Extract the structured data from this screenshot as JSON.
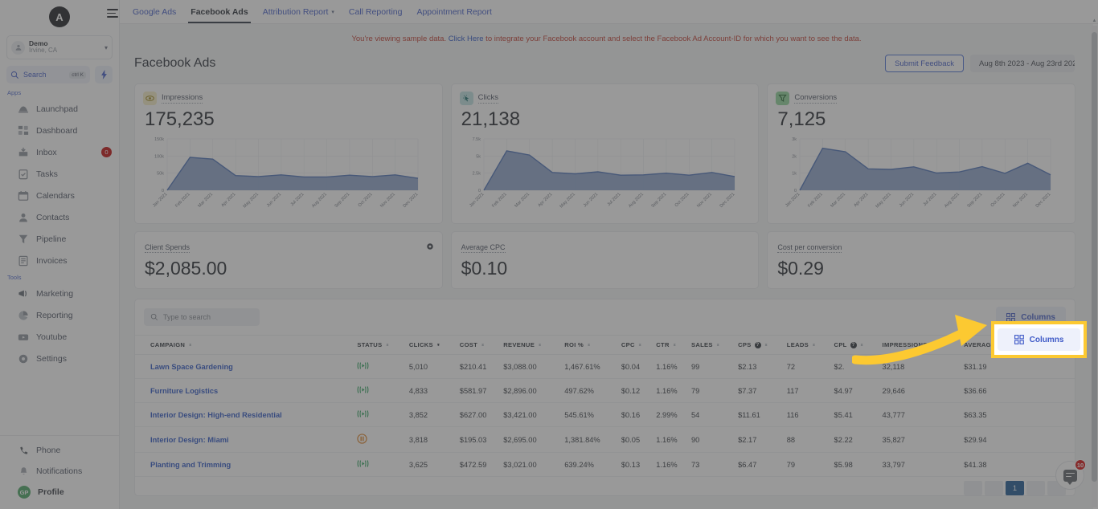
{
  "brand": {
    "logo_letter": "A",
    "accent": "#3f5ac7",
    "highlight": "#fcc931"
  },
  "sidebar": {
    "account": {
      "name": "Demo",
      "location": "Irvine, CA"
    },
    "search": {
      "label": "Search",
      "shortcut": "ctrl K"
    },
    "groups": [
      {
        "label": "Apps",
        "items": [
          {
            "label": "Launchpad",
            "icon": "rocket-icon",
            "badge": ""
          },
          {
            "label": "Dashboard",
            "icon": "dashboard-icon",
            "badge": ""
          },
          {
            "label": "Inbox",
            "icon": "inbox-icon",
            "badge": "0"
          },
          {
            "label": "Tasks",
            "icon": "tasks-icon",
            "badge": ""
          },
          {
            "label": "Calendars",
            "icon": "calendar-icon",
            "badge": ""
          },
          {
            "label": "Contacts",
            "icon": "contacts-icon",
            "badge": ""
          },
          {
            "label": "Pipeline",
            "icon": "pipeline-icon",
            "badge": ""
          },
          {
            "label": "Invoices",
            "icon": "invoices-icon",
            "badge": ""
          }
        ]
      },
      {
        "label": "Tools",
        "items": [
          {
            "label": "Marketing",
            "icon": "megaphone-icon",
            "badge": ""
          },
          {
            "label": "Reporting",
            "icon": "pie-chart-icon",
            "badge": ""
          },
          {
            "label": "Youtube",
            "icon": "youtube-icon",
            "badge": ""
          },
          {
            "label": "Settings",
            "icon": "gear-icon",
            "badge": ""
          }
        ]
      }
    ],
    "bottom": [
      {
        "label": "Phone",
        "icon": "phone-icon"
      },
      {
        "label": "Notifications",
        "icon": "bell-icon"
      },
      {
        "label": "Profile",
        "icon": "avatar",
        "initials": "GP"
      }
    ]
  },
  "topbar": {
    "tabs": [
      {
        "label": "Google Ads",
        "active": false,
        "caret": false
      },
      {
        "label": "Facebook Ads",
        "active": true,
        "caret": false
      },
      {
        "label": "Attribution Report",
        "active": false,
        "caret": true
      },
      {
        "label": "Call Reporting",
        "active": false,
        "caret": false
      },
      {
        "label": "Appointment Report",
        "active": false,
        "caret": false
      }
    ]
  },
  "notice": {
    "before": "You're viewing sample data. ",
    "link": "Click Here",
    "after": " to integrate your Facebook account and select the Facebook Ad Account-ID for which you want to see the data."
  },
  "header": {
    "title": "Facebook Ads",
    "feedback_label": "Submit Feedback",
    "date_range": "Aug 8th 2023 - Aug 23rd 202"
  },
  "kpi_cards": [
    {
      "label": "Impressions",
      "value": "175,235",
      "icon": "eye-icon",
      "icon_bg": "#f7eec6",
      "icon_color": "#9a8417"
    },
    {
      "label": "Clicks",
      "value": "21,138",
      "icon": "cursor-click-icon",
      "icon_bg": "#bfe3e3",
      "icon_color": "#1c6e6e"
    },
    {
      "label": "Conversions",
      "value": "7,125",
      "icon": "funnel-icon",
      "icon_bg": "#8fd49a",
      "icon_color": "#1f5f2c"
    }
  ],
  "spend_cards": [
    {
      "label": "Client Spends",
      "value": "$2,085.00",
      "has_gear": true
    },
    {
      "label": "Average CPC",
      "value": "$0.10",
      "has_gear": false
    },
    {
      "label": "Cost per conversion",
      "value": "$0.29",
      "has_gear": false
    }
  ],
  "table": {
    "search_placeholder": "Type to search",
    "columns_label": "Columns",
    "columns": [
      {
        "label": "CAMPAIGN",
        "sortable": true,
        "active_sort": false,
        "info": false,
        "align": "left"
      },
      {
        "label": "STATUS",
        "sortable": true,
        "active_sort": false,
        "info": false,
        "align": "left"
      },
      {
        "label": "CLICKS",
        "sortable": true,
        "active_sort": true,
        "info": false,
        "align": "left"
      },
      {
        "label": "COST",
        "sortable": true,
        "active_sort": false,
        "info": false,
        "align": "left"
      },
      {
        "label": "REVENUE",
        "sortable": true,
        "active_sort": false,
        "info": false,
        "align": "left"
      },
      {
        "label": "ROI %",
        "sortable": true,
        "active_sort": false,
        "info": false,
        "align": "left"
      },
      {
        "label": "CPC",
        "sortable": true,
        "active_sort": false,
        "info": false,
        "align": "left"
      },
      {
        "label": "CTR",
        "sortable": true,
        "active_sort": false,
        "info": false,
        "align": "left"
      },
      {
        "label": "SALES",
        "sortable": true,
        "active_sort": false,
        "info": false,
        "align": "left"
      },
      {
        "label": "CPS",
        "sortable": true,
        "active_sort": false,
        "info": true,
        "align": "left"
      },
      {
        "label": "LEADS",
        "sortable": true,
        "active_sort": false,
        "info": false,
        "align": "left"
      },
      {
        "label": "CPL",
        "sortable": true,
        "active_sort": false,
        "info": true,
        "align": "left"
      },
      {
        "label": "IMPRESSIONS",
        "sortable": true,
        "active_sort": false,
        "info": false,
        "align": "left"
      },
      {
        "label": "AVERAGE REVENUE",
        "sortable": true,
        "active_sort": false,
        "info": false,
        "align": "left"
      }
    ],
    "rows": [
      {
        "campaign": "Lawn Space Gardening",
        "status": "active",
        "clicks": "5,010",
        "cost": "$210.41",
        "revenue": "$3,088.00",
        "roi": "1,467.61%",
        "cpc": "$0.04",
        "ctr": "1.16%",
        "sales": "99",
        "cps": "$2.13",
        "leads": "72",
        "cpl": "$2.",
        "impressions": "32,118",
        "avg_revenue": "$31.19"
      },
      {
        "campaign": "Furniture Logistics",
        "status": "active",
        "clicks": "4,833",
        "cost": "$581.97",
        "revenue": "$2,896.00",
        "roi": "497.62%",
        "cpc": "$0.12",
        "ctr": "1.16%",
        "sales": "79",
        "cps": "$7.37",
        "leads": "117",
        "cpl": "$4.97",
        "impressions": "29,646",
        "avg_revenue": "$36.66"
      },
      {
        "campaign": "Interior Design: High-end Residential",
        "status": "active",
        "clicks": "3,852",
        "cost": "$627.00",
        "revenue": "$3,421.00",
        "roi": "545.61%",
        "cpc": "$0.16",
        "ctr": "2.99%",
        "sales": "54",
        "cps": "$11.61",
        "leads": "116",
        "cpl": "$5.41",
        "impressions": "43,777",
        "avg_revenue": "$63.35"
      },
      {
        "campaign": "Interior Design: Miami",
        "status": "paused",
        "clicks": "3,818",
        "cost": "$195.03",
        "revenue": "$2,695.00",
        "roi": "1,381.84%",
        "cpc": "$0.05",
        "ctr": "1.16%",
        "sales": "90",
        "cps": "$2.17",
        "leads": "88",
        "cpl": "$2.22",
        "impressions": "35,827",
        "avg_revenue": "$29.94"
      },
      {
        "campaign": "Planting and Trimming",
        "status": "active",
        "clicks": "3,625",
        "cost": "$472.59",
        "revenue": "$3,021.00",
        "roi": "639.24%",
        "cpc": "$0.13",
        "ctr": "1.16%",
        "sales": "73",
        "cps": "$6.47",
        "leads": "79",
        "cpl": "$5.98",
        "impressions": "33,797",
        "avg_revenue": "$41.38"
      }
    ],
    "pagination": {
      "pages": [
        "",
        "",
        "1",
        "",
        ""
      ],
      "current": "1"
    }
  },
  "chat_widget": {
    "badge": "10",
    "icon": "chat-bubble-icon"
  },
  "chart_data": [
    {
      "type": "area",
      "title": "Impressions",
      "x": [
        "Jan 2021",
        "Feb 2021",
        "Mar 2021",
        "Apr 2021",
        "May 2021",
        "Jun 2021",
        "Jul 2021",
        "Aug 2021",
        "Sep 2021",
        "Oct 2021",
        "Nov 2021",
        "Dec 2021"
      ],
      "values": [
        0,
        96000,
        91000,
        43000,
        40000,
        45000,
        39000,
        39000,
        44000,
        40000,
        45000,
        35000
      ],
      "ylim": [
        0,
        150000
      ],
      "yticks": [
        0,
        50000,
        100000,
        150000
      ],
      "ytick_labels": [
        "0",
        "50k",
        "100k",
        "150k"
      ],
      "xlabel": "",
      "ylabel": "",
      "grid": true,
      "legend": false,
      "series_color": "#4a6fb5",
      "fill_color": "#7b95c4"
    },
    {
      "type": "area",
      "title": "Clicks",
      "x": [
        "Jan 2021",
        "Feb 2021",
        "Mar 2021",
        "Apr 2021",
        "May 2021",
        "Jun 2021",
        "Jul 2021",
        "Aug 2021",
        "Sep 2021",
        "Oct 2021",
        "Nov 2021",
        "Dec 2021"
      ],
      "values": [
        0,
        5750,
        5150,
        2600,
        2400,
        2700,
        2200,
        2250,
        2500,
        2200,
        2600,
        2000
      ],
      "ylim": [
        0,
        7500
      ],
      "yticks": [
        0,
        2500,
        5000,
        7500
      ],
      "ytick_labels": [
        "0",
        "2.5k",
        "5k",
        "7.5k"
      ],
      "xlabel": "",
      "ylabel": "",
      "grid": true,
      "legend": false,
      "series_color": "#4a6fb5",
      "fill_color": "#7b95c4"
    },
    {
      "type": "area",
      "title": "Conversions",
      "x": [
        "Jan 2021",
        "Feb 2021",
        "Mar 2021",
        "Apr 2021",
        "May 2021",
        "Jun 2021",
        "Jul 2021",
        "Aug 2021",
        "Sep 2021",
        "Oct 2021",
        "Nov 2021",
        "Dec 2021"
      ],
      "values": [
        0,
        2450,
        2250,
        1250,
        1220,
        1370,
        1010,
        1070,
        1380,
        990,
        1580,
        900
      ],
      "ylim": [
        0,
        3000
      ],
      "yticks": [
        0,
        1000,
        2000,
        3000
      ],
      "ytick_labels": [
        "0",
        "1k",
        "2k",
        "3k"
      ],
      "xlabel": "",
      "ylabel": "",
      "grid": true,
      "legend": false,
      "series_color": "#4a6fb5",
      "fill_color": "#7b95c4"
    }
  ]
}
